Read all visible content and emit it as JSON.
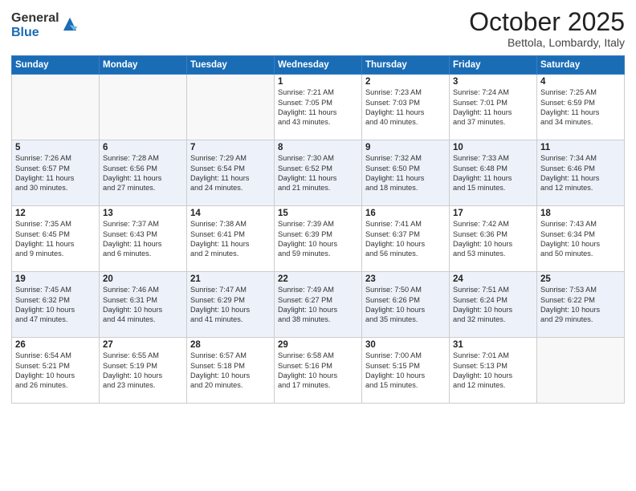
{
  "header": {
    "logo_general": "General",
    "logo_blue": "Blue",
    "month": "October 2025",
    "location": "Bettola, Lombardy, Italy"
  },
  "days_of_week": [
    "Sunday",
    "Monday",
    "Tuesday",
    "Wednesday",
    "Thursday",
    "Friday",
    "Saturday"
  ],
  "weeks": [
    [
      {
        "day": "",
        "info": ""
      },
      {
        "day": "",
        "info": ""
      },
      {
        "day": "",
        "info": ""
      },
      {
        "day": "1",
        "info": "Sunrise: 7:21 AM\nSunset: 7:05 PM\nDaylight: 11 hours\nand 43 minutes."
      },
      {
        "day": "2",
        "info": "Sunrise: 7:23 AM\nSunset: 7:03 PM\nDaylight: 11 hours\nand 40 minutes."
      },
      {
        "day": "3",
        "info": "Sunrise: 7:24 AM\nSunset: 7:01 PM\nDaylight: 11 hours\nand 37 minutes."
      },
      {
        "day": "4",
        "info": "Sunrise: 7:25 AM\nSunset: 6:59 PM\nDaylight: 11 hours\nand 34 minutes."
      }
    ],
    [
      {
        "day": "5",
        "info": "Sunrise: 7:26 AM\nSunset: 6:57 PM\nDaylight: 11 hours\nand 30 minutes."
      },
      {
        "day": "6",
        "info": "Sunrise: 7:28 AM\nSunset: 6:56 PM\nDaylight: 11 hours\nand 27 minutes."
      },
      {
        "day": "7",
        "info": "Sunrise: 7:29 AM\nSunset: 6:54 PM\nDaylight: 11 hours\nand 24 minutes."
      },
      {
        "day": "8",
        "info": "Sunrise: 7:30 AM\nSunset: 6:52 PM\nDaylight: 11 hours\nand 21 minutes."
      },
      {
        "day": "9",
        "info": "Sunrise: 7:32 AM\nSunset: 6:50 PM\nDaylight: 11 hours\nand 18 minutes."
      },
      {
        "day": "10",
        "info": "Sunrise: 7:33 AM\nSunset: 6:48 PM\nDaylight: 11 hours\nand 15 minutes."
      },
      {
        "day": "11",
        "info": "Sunrise: 7:34 AM\nSunset: 6:46 PM\nDaylight: 11 hours\nand 12 minutes."
      }
    ],
    [
      {
        "day": "12",
        "info": "Sunrise: 7:35 AM\nSunset: 6:45 PM\nDaylight: 11 hours\nand 9 minutes."
      },
      {
        "day": "13",
        "info": "Sunrise: 7:37 AM\nSunset: 6:43 PM\nDaylight: 11 hours\nand 6 minutes."
      },
      {
        "day": "14",
        "info": "Sunrise: 7:38 AM\nSunset: 6:41 PM\nDaylight: 11 hours\nand 2 minutes."
      },
      {
        "day": "15",
        "info": "Sunrise: 7:39 AM\nSunset: 6:39 PM\nDaylight: 10 hours\nand 59 minutes."
      },
      {
        "day": "16",
        "info": "Sunrise: 7:41 AM\nSunset: 6:37 PM\nDaylight: 10 hours\nand 56 minutes."
      },
      {
        "day": "17",
        "info": "Sunrise: 7:42 AM\nSunset: 6:36 PM\nDaylight: 10 hours\nand 53 minutes."
      },
      {
        "day": "18",
        "info": "Sunrise: 7:43 AM\nSunset: 6:34 PM\nDaylight: 10 hours\nand 50 minutes."
      }
    ],
    [
      {
        "day": "19",
        "info": "Sunrise: 7:45 AM\nSunset: 6:32 PM\nDaylight: 10 hours\nand 47 minutes."
      },
      {
        "day": "20",
        "info": "Sunrise: 7:46 AM\nSunset: 6:31 PM\nDaylight: 10 hours\nand 44 minutes."
      },
      {
        "day": "21",
        "info": "Sunrise: 7:47 AM\nSunset: 6:29 PM\nDaylight: 10 hours\nand 41 minutes."
      },
      {
        "day": "22",
        "info": "Sunrise: 7:49 AM\nSunset: 6:27 PM\nDaylight: 10 hours\nand 38 minutes."
      },
      {
        "day": "23",
        "info": "Sunrise: 7:50 AM\nSunset: 6:26 PM\nDaylight: 10 hours\nand 35 minutes."
      },
      {
        "day": "24",
        "info": "Sunrise: 7:51 AM\nSunset: 6:24 PM\nDaylight: 10 hours\nand 32 minutes."
      },
      {
        "day": "25",
        "info": "Sunrise: 7:53 AM\nSunset: 6:22 PM\nDaylight: 10 hours\nand 29 minutes."
      }
    ],
    [
      {
        "day": "26",
        "info": "Sunrise: 6:54 AM\nSunset: 5:21 PM\nDaylight: 10 hours\nand 26 minutes."
      },
      {
        "day": "27",
        "info": "Sunrise: 6:55 AM\nSunset: 5:19 PM\nDaylight: 10 hours\nand 23 minutes."
      },
      {
        "day": "28",
        "info": "Sunrise: 6:57 AM\nSunset: 5:18 PM\nDaylight: 10 hours\nand 20 minutes."
      },
      {
        "day": "29",
        "info": "Sunrise: 6:58 AM\nSunset: 5:16 PM\nDaylight: 10 hours\nand 17 minutes."
      },
      {
        "day": "30",
        "info": "Sunrise: 7:00 AM\nSunset: 5:15 PM\nDaylight: 10 hours\nand 15 minutes."
      },
      {
        "day": "31",
        "info": "Sunrise: 7:01 AM\nSunset: 5:13 PM\nDaylight: 10 hours\nand 12 minutes."
      },
      {
        "day": "",
        "info": ""
      }
    ]
  ]
}
